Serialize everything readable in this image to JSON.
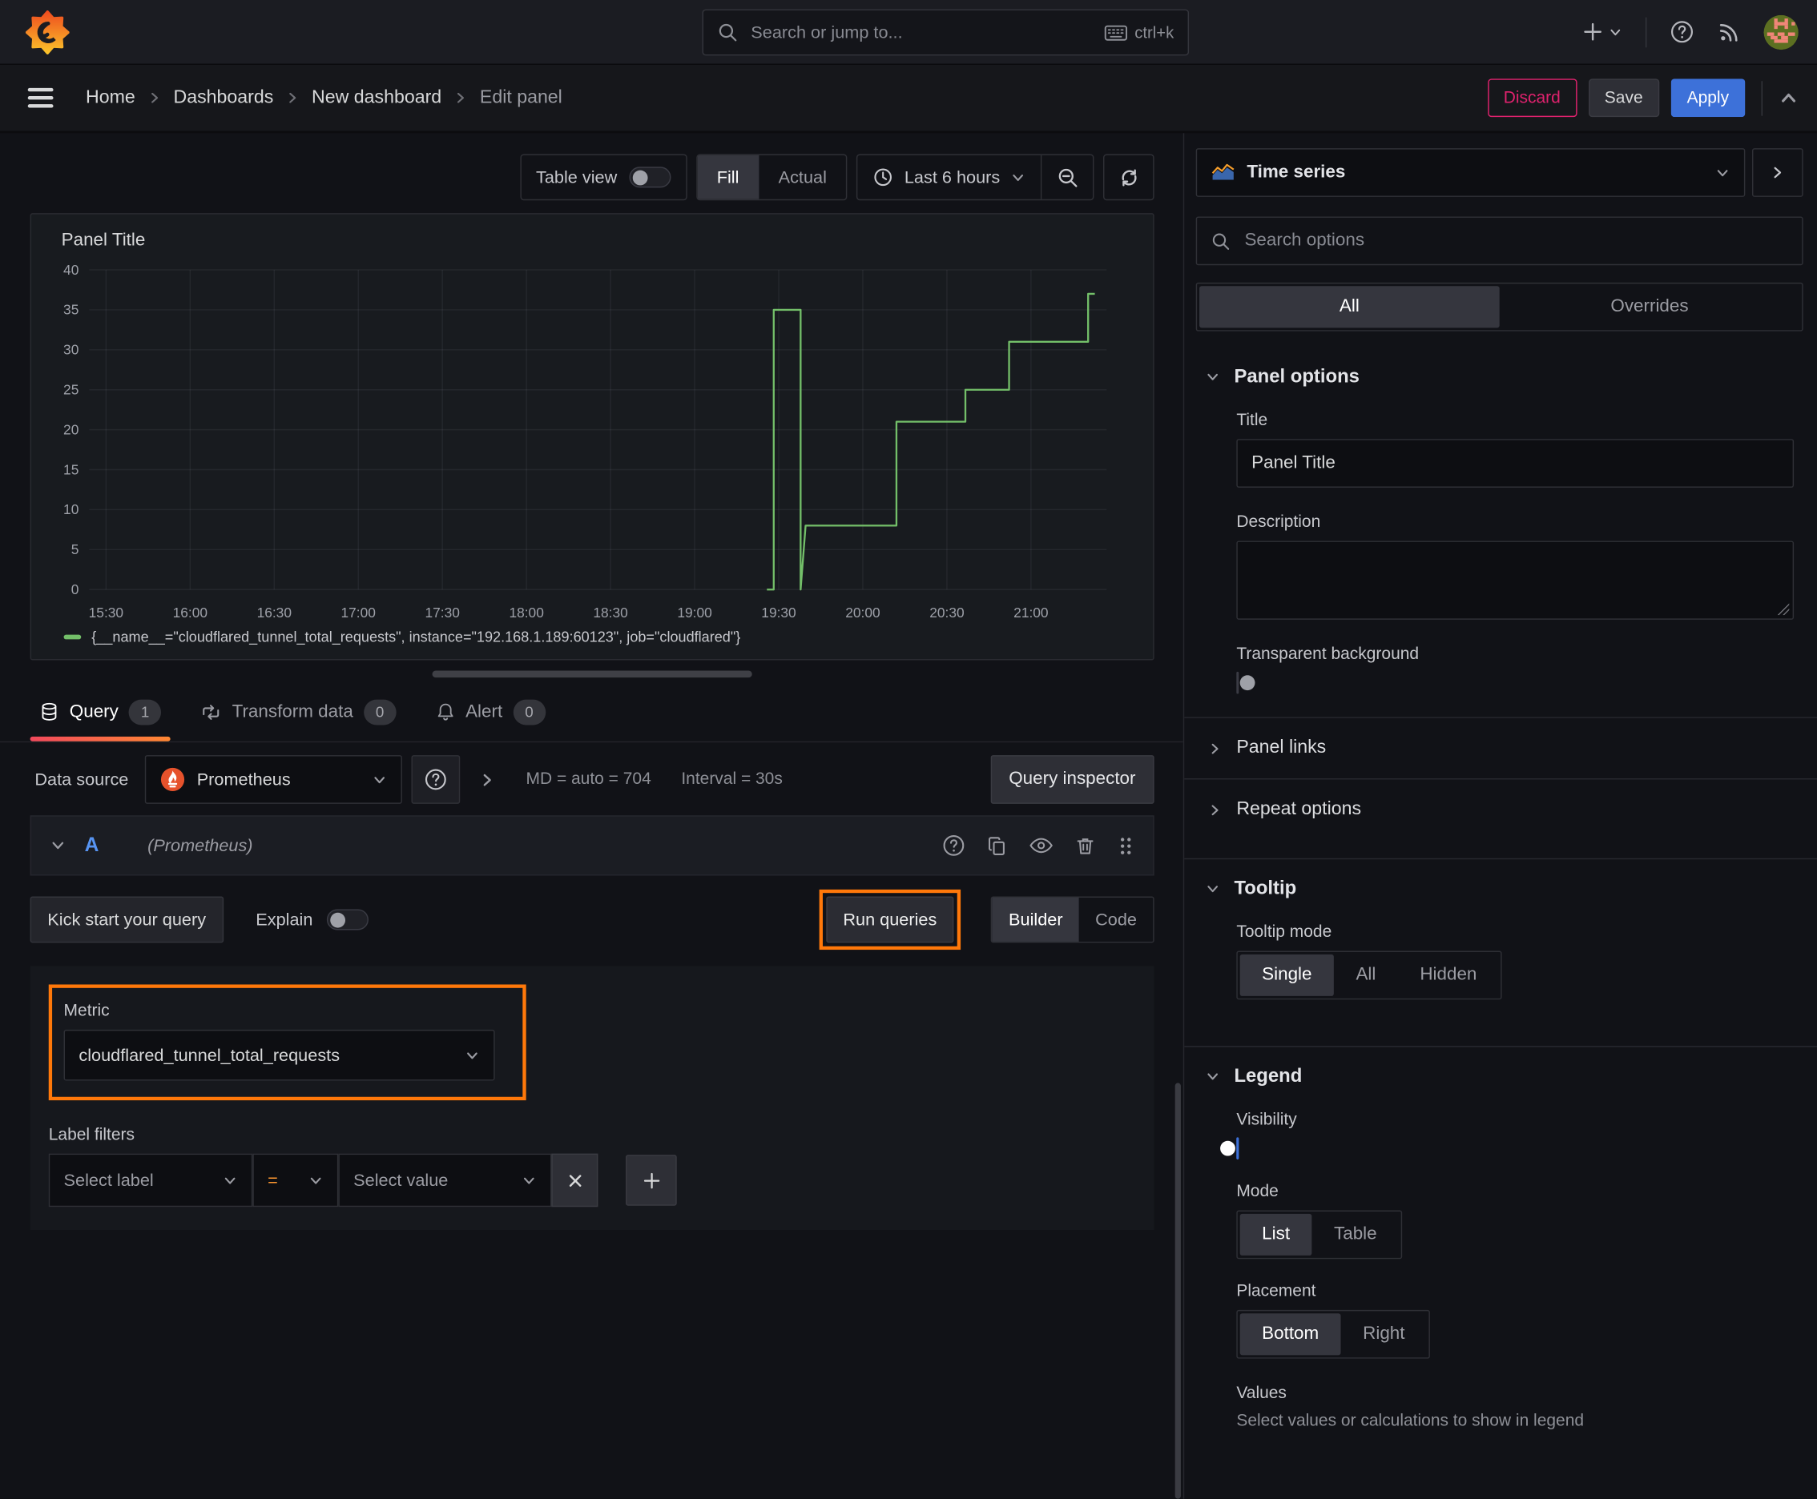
{
  "topbar": {
    "search_placeholder": "Search or jump to...",
    "shortcut": "ctrl+k"
  },
  "breadcrumb": {
    "items": [
      "Home",
      "Dashboards",
      "New dashboard",
      "Edit panel"
    ]
  },
  "actions": {
    "discard": "Discard",
    "save": "Save",
    "apply": "Apply"
  },
  "viz_toolbar": {
    "table_view": "Table view",
    "fill": "Fill",
    "actual": "Actual",
    "time_range": "Last 6 hours"
  },
  "panel": {
    "title": "Panel Title",
    "legend": "{__name__=\"cloudflared_tunnel_total_requests\", instance=\"192.168.1.189:60123\", job=\"cloudflared\"}"
  },
  "chart_data": {
    "type": "line",
    "title": "Panel Title",
    "x_range": [
      15.4,
      21.45
    ],
    "y_range": [
      0,
      40
    ],
    "grid": true,
    "legend_position": "bottom",
    "x_ticks": [
      {
        "t": 15.5,
        "label": "15:30"
      },
      {
        "t": 16.0,
        "label": "16:00"
      },
      {
        "t": 16.5,
        "label": "16:30"
      },
      {
        "t": 17.0,
        "label": "17:00"
      },
      {
        "t": 17.5,
        "label": "17:30"
      },
      {
        "t": 18.0,
        "label": "18:00"
      },
      {
        "t": 18.5,
        "label": "18:30"
      },
      {
        "t": 19.0,
        "label": "19:00"
      },
      {
        "t": 19.5,
        "label": "19:30"
      },
      {
        "t": 20.0,
        "label": "20:00"
      },
      {
        "t": 20.5,
        "label": "20:30"
      },
      {
        "t": 21.0,
        "label": "21:00"
      }
    ],
    "y_ticks": [
      0,
      5,
      10,
      15,
      20,
      25,
      30,
      35,
      40
    ],
    "series": [
      {
        "name": "{__name__=\"cloudflared_tunnel_total_requests\", instance=\"192.168.1.189:60123\", job=\"cloudflared\"}",
        "color": "#73bf69",
        "points": [
          [
            19.43,
            0
          ],
          [
            19.47,
            0
          ],
          [
            19.47,
            35
          ],
          [
            19.63,
            35
          ],
          [
            19.63,
            0
          ],
          [
            19.66,
            8
          ],
          [
            20.2,
            8
          ],
          [
            20.2,
            21
          ],
          [
            20.61,
            21
          ],
          [
            20.61,
            25
          ],
          [
            20.87,
            25
          ],
          [
            20.87,
            31
          ],
          [
            21.34,
            31
          ],
          [
            21.34,
            37
          ],
          [
            21.38,
            37
          ]
        ]
      }
    ]
  },
  "tabs": {
    "query": {
      "label": "Query",
      "count": "1"
    },
    "transform": {
      "label": "Transform data",
      "count": "0"
    },
    "alert": {
      "label": "Alert",
      "count": "0"
    }
  },
  "datasource": {
    "label": "Data source",
    "value": "Prometheus",
    "stats_md": "MD = auto = 704",
    "stats_interval": "Interval = 30s",
    "query_inspector": "Query inspector"
  },
  "query": {
    "ref": "A",
    "ds_hint": "(Prometheus)",
    "kickstart": "Kick start your query",
    "explain": "Explain",
    "run": "Run queries",
    "builder": "Builder",
    "code": "Code",
    "metric_label": "Metric",
    "metric_value": "cloudflared_tunnel_total_requests",
    "label_filters": "Label filters",
    "select_label": "Select label",
    "operator": "=",
    "select_value": "Select value"
  },
  "sidebar": {
    "viz_type": "Time series",
    "search_placeholder": "Search options",
    "tab_all": "All",
    "tab_overrides": "Overrides",
    "panel_options": {
      "heading": "Panel options",
      "title_label": "Title",
      "title_value": "Panel Title",
      "description_label": "Description",
      "transparent_label": "Transparent background"
    },
    "panel_links": "Panel links",
    "repeat_options": "Repeat options",
    "tooltip": {
      "heading": "Tooltip",
      "mode_label": "Tooltip mode",
      "opt_single": "Single",
      "opt_all": "All",
      "opt_hidden": "Hidden"
    },
    "legend": {
      "heading": "Legend",
      "visibility_label": "Visibility",
      "mode_label": "Mode",
      "opt_list": "List",
      "opt_table": "Table",
      "placement_label": "Placement",
      "opt_bottom": "Bottom",
      "opt_right": "Right",
      "values_label": "Values",
      "values_hint": "Select values or calculations to show in legend"
    }
  },
  "colors": {
    "series_green": "#73bf69",
    "accent_blue": "#3d71d9",
    "annotation_orange": "#ff780a",
    "discard_pink": "#e0226e",
    "tab_underline_from": "#f2495c",
    "tab_underline_to": "#ff8833"
  }
}
